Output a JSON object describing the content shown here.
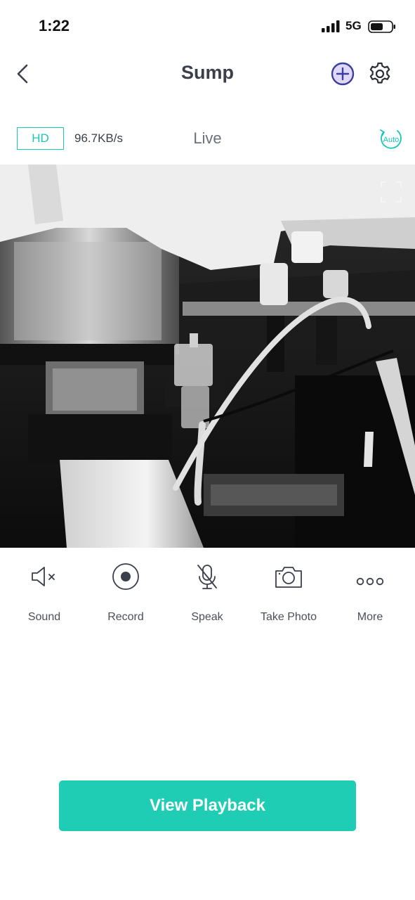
{
  "status_bar": {
    "time": "1:22",
    "network": "5G"
  },
  "nav": {
    "title": "Sump"
  },
  "stream": {
    "quality": "HD",
    "bitrate": "96.7KB/s",
    "mode": "Live",
    "auto_label": "Auto"
  },
  "controls": [
    {
      "label": "Sound",
      "icon": "speaker-muted-icon"
    },
    {
      "label": "Record",
      "icon": "record-icon"
    },
    {
      "label": "Speak",
      "icon": "mic-off-icon"
    },
    {
      "label": "Take Photo",
      "icon": "camera-icon"
    },
    {
      "label": "More",
      "icon": "more-dots-icon"
    }
  ],
  "actions": {
    "view_playback": "View Playback"
  },
  "colors": {
    "accent": "#1fcdb5",
    "add_highlight": "#dcd4f7",
    "text": "#3a3f4b"
  }
}
